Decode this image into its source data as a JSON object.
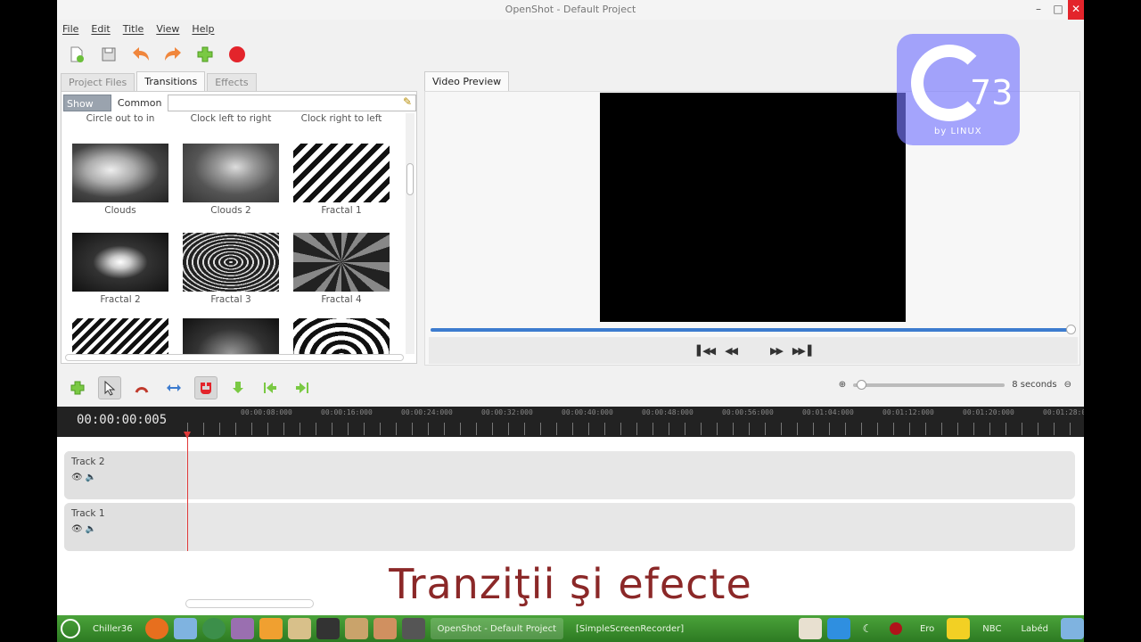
{
  "window": {
    "title": "OpenShot - Default Project"
  },
  "menu": [
    "File",
    "Edit",
    "Title",
    "View",
    "Help"
  ],
  "left_tabs": [
    "Project Files",
    "Transitions",
    "Effects"
  ],
  "filters": {
    "show_all": "Show All",
    "common": "Common",
    "search_value": ""
  },
  "transitions": [
    {
      "label": "Circle out to in"
    },
    {
      "label": "Clock left to right"
    },
    {
      "label": "Clock right to left"
    },
    {
      "label": "Clouds"
    },
    {
      "label": "Clouds 2"
    },
    {
      "label": "Fractal 1"
    },
    {
      "label": "Fractal 2"
    },
    {
      "label": "Fractal 3"
    },
    {
      "label": "Fractal 4"
    }
  ],
  "preview": {
    "tab": "Video Preview"
  },
  "timeline": {
    "current_time": "00:00:00:005",
    "zoom_label": "8 seconds",
    "marks": [
      "00:00:08:000",
      "00:00:16:000",
      "00:00:24:000",
      "00:00:32:000",
      "00:00:40:000",
      "00:00:48:000",
      "00:00:56:000",
      "00:01:04:000",
      "00:01:12:000",
      "00:01:20:000",
      "00:01:28:0"
    ],
    "tracks": [
      {
        "name": "Track 2"
      },
      {
        "name": "Track 1"
      }
    ]
  },
  "overlay": {
    "caption": "Tranziţii şi efecte",
    "logo_number": "73",
    "logo_by": "by LINUX"
  },
  "taskbar": {
    "menu_label": "Chiller36",
    "tasks": [
      "OpenShot - Default Project",
      "[SimpleScreenRecorder]"
    ],
    "tray_texts": [
      "Ero",
      "NBC",
      "Labéd"
    ]
  },
  "colors": {
    "accent": "#3d7ccf",
    "record": "#e3242b",
    "caption": "#8b2828",
    "taskbar": "#3a8f2c"
  }
}
